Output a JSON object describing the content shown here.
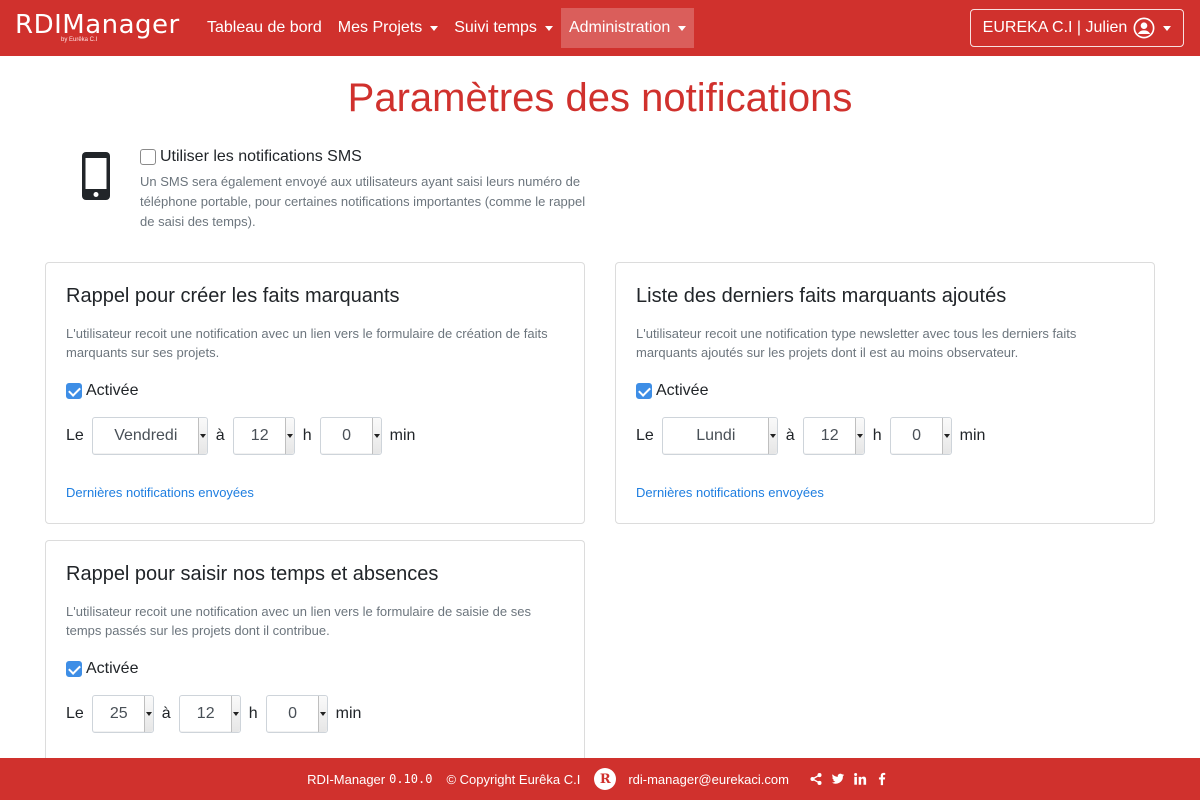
{
  "brand": {
    "name_part1": "RDI",
    "name_part2": "Manager",
    "tagline": "by Eurêka C.I"
  },
  "nav": {
    "items": [
      {
        "label": "Tableau de bord",
        "dropdown": false
      },
      {
        "label": "Mes Projets",
        "dropdown": true
      },
      {
        "label": "Suivi temps",
        "dropdown": true
      },
      {
        "label": "Administration",
        "dropdown": true,
        "active": true
      }
    ],
    "user": {
      "label": "EUREKA C.I | Julien"
    }
  },
  "page": {
    "title": "Paramètres des notifications"
  },
  "sms": {
    "checkbox_label": "Utiliser les notifications SMS",
    "checked": false,
    "description": "Un SMS sera également envoyé aux utilisateurs ayant saisi leurs numéro de téléphone portable, pour certaines notifications importantes (comme le rappel de saisi des temps)."
  },
  "cards": [
    {
      "title": "Rappel pour créer les faits marquants",
      "description": "L'utilisateur recoit une notification avec un lien vers le formulaire de création de faits marquants sur ses projets.",
      "active_label": "Activée",
      "active": true,
      "prefix": "Le",
      "day": "Vendredi",
      "at": "à",
      "hour": "12",
      "h": "h",
      "minute": "0",
      "min": "min",
      "link": "Dernières notifications envoyées"
    },
    {
      "title": "Liste des derniers faits marquants ajoutés",
      "description": "L'utilisateur recoit une notification type newsletter avec tous les derniers faits marquants ajoutés sur les projets dont il est au moins observateur.",
      "active_label": "Activée",
      "active": true,
      "prefix": "Le",
      "day": "Lundi",
      "at": "à",
      "hour": "12",
      "h": "h",
      "minute": "0",
      "min": "min",
      "link": "Dernières notifications envoyées"
    },
    {
      "title": "Rappel pour saisir nos temps et absences",
      "description": "L'utilisateur recoit une notification avec un lien vers le formulaire de saisie de ses temps passés sur les projets dont il contribue.",
      "active_label": "Activée",
      "active": true,
      "prefix": "Le",
      "day": "25",
      "at": "à",
      "hour": "12",
      "h": "h",
      "minute": "0",
      "min": "min"
    }
  ],
  "footer": {
    "app": "RDI-Manager",
    "version": "0.10.0",
    "copyright": "© Copyright Eurêka C.I",
    "logo_letter": "R",
    "email": "rdi-manager@eurekaci.com",
    "social_icons": [
      "share-icon",
      "twitter-icon",
      "linkedin-icon",
      "facebook-icon"
    ]
  },
  "colors": {
    "brand_red": "#d0312d",
    "link_blue": "#1e7ee0",
    "check_blue": "#3e8ee6"
  }
}
